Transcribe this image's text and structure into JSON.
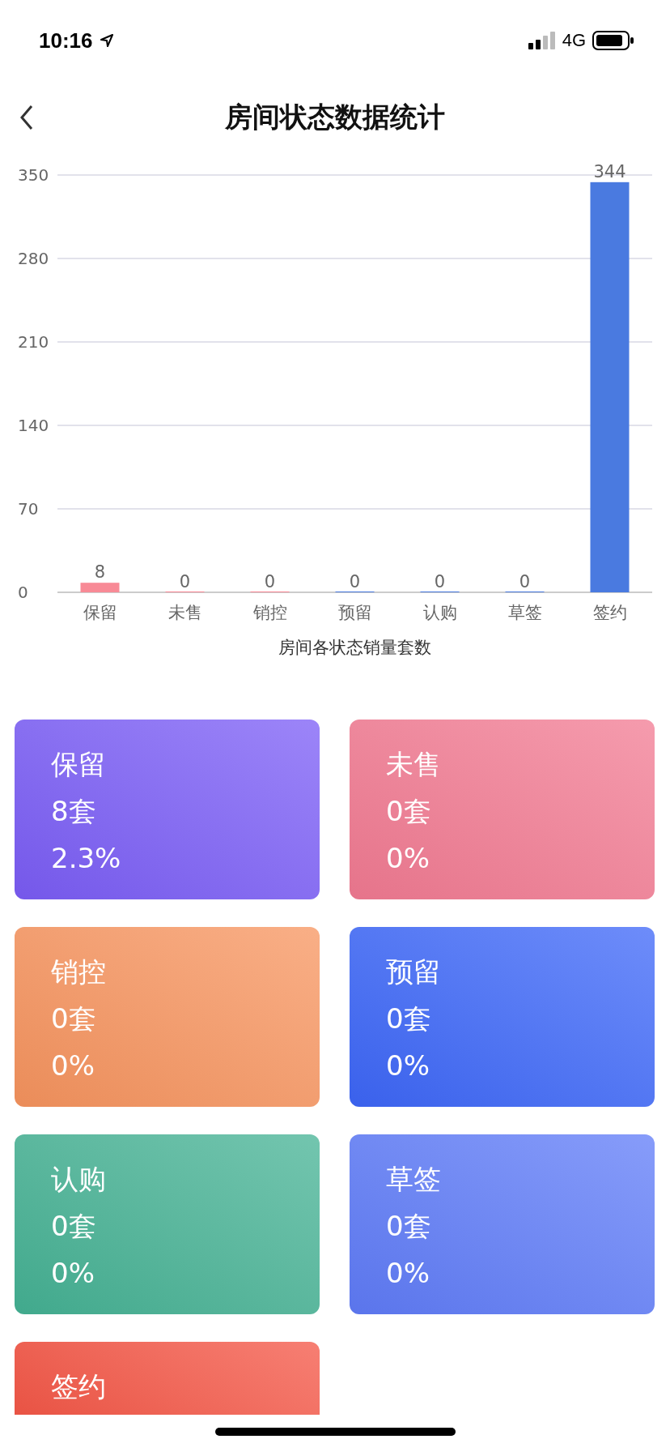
{
  "status_bar": {
    "time": "10:16",
    "network": "4G"
  },
  "nav": {
    "title": "房间状态数据统计"
  },
  "chart_data": {
    "type": "bar",
    "xlabel": "房间各状态销量套数",
    "categories": [
      "保留",
      "未售",
      "销控",
      "预留",
      "认购",
      "草签",
      "签约"
    ],
    "series": [
      {
        "color": "#f88a96",
        "values": [
          8,
          0,
          0,
          null,
          null,
          null,
          null
        ]
      },
      {
        "color": "#4a7ae0",
        "values": [
          null,
          null,
          null,
          0,
          0,
          0,
          344
        ]
      }
    ],
    "ylim": [
      0,
      350
    ],
    "yticks": [
      0,
      70,
      140,
      210,
      280,
      350
    ],
    "grid": true,
    "data_labels": true
  },
  "cards": [
    {
      "name": "保留",
      "count": "8套",
      "percent": "2.3%",
      "color": "#7b5cf6"
    },
    {
      "name": "未售",
      "count": "0套",
      "percent": "0%",
      "color": "#f27a92"
    },
    {
      "name": "销控",
      "count": "0套",
      "percent": "0%",
      "color": "#f7945e"
    },
    {
      "name": "预留",
      "count": "0套",
      "percent": "0%",
      "color": "#3d66f8"
    },
    {
      "name": "认购",
      "count": "0套",
      "percent": "0%",
      "color": "#44b294"
    },
    {
      "name": "草签",
      "count": "0套",
      "percent": "0%",
      "color": "#5f7bf8"
    },
    {
      "name": "签约",
      "kind": "partial",
      "color": "#f45444"
    }
  ]
}
